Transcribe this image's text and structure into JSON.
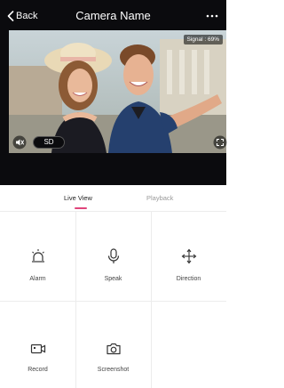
{
  "header": {
    "back_label": "Back",
    "title": "Camera Name",
    "more_icon": "more-horizontal-icon"
  },
  "video": {
    "signal_text": "Signal : 69%",
    "quality_label": "SD",
    "mute_icon": "speaker-mute-icon",
    "fullscreen_icon": "fullscreen-icon"
  },
  "tabs": [
    {
      "label": "Live View",
      "active": true
    },
    {
      "label": "Playback",
      "active": false
    }
  ],
  "actions": [
    {
      "label": "Alarm",
      "icon": "alarm-light-icon"
    },
    {
      "label": "Speak",
      "icon": "microphone-icon"
    },
    {
      "label": "Direction",
      "icon": "direction-arrows-icon"
    },
    {
      "label": "Record",
      "icon": "video-record-icon"
    },
    {
      "label": "Screenshot",
      "icon": "camera-icon"
    }
  ],
  "colors": {
    "accent": "#e0457b",
    "header_bg": "#0b0b0e"
  }
}
